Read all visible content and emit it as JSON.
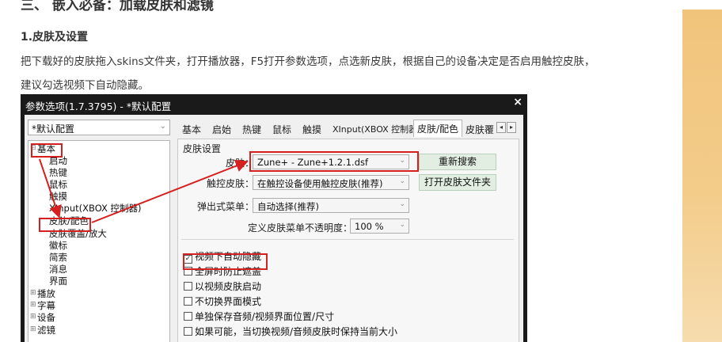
{
  "article": {
    "section_heading": "三、 嵌入必备：加载皮肤和滤镜",
    "sub_heading": "1.皮肤及设置",
    "paragraph_line1": "把下载好的皮肤拖入skins文件夹，打开播放器，F5打开参数选项，点选新皮肤，根据自己的设备决定是否启用触控皮肤，",
    "paragraph_line2": "建议勾选视频下自动隐藏。"
  },
  "window": {
    "title": "参数选项(1.7.3795) - *默认配置",
    "close_glyph": "×",
    "profile": "*默认配置"
  },
  "tree": {
    "basic": "基本",
    "start": "启动",
    "hotkey": "热键",
    "mouse": "鼠标",
    "touch": "触摸",
    "xinput": "XInput(XBOX 控制器)",
    "skin_color": "皮肤/配色",
    "skin_overlay": "皮肤覆盖/放大",
    "logo": "徽标",
    "minimal": "简索",
    "message": "消息",
    "ui": "界面",
    "playback": "播放",
    "subtitle": "字幕",
    "device": "设备",
    "filter": "滤镜"
  },
  "tabs": [
    "基本",
    "启始",
    "热键",
    "鼠标",
    "触摸",
    "XInput(XBOX 控制器)",
    "皮肤/配色",
    "皮肤覆"
  ],
  "tab_scroll": {
    "left": "◂",
    "right": "▸"
  },
  "skin_settings": {
    "group_label": "皮肤设置",
    "skin_label": "皮肤：",
    "skin_value": "Zune+ - Zune+1.2.1.dsf",
    "research_button": "重新搜索",
    "touch_skin_label": "触控皮肤：",
    "touch_skin_value": "在触控设备使用触控皮肤(推荐)",
    "open_folder_button": "打开皮肤文件夹",
    "popup_menu_label": "弹出式菜单：",
    "popup_menu_value": "自动选择(推荐)",
    "opacity_label": "定义皮肤菜单不透明度：",
    "opacity_value": "100 %"
  },
  "options": [
    {
      "label": "视频下自动隐藏",
      "checked": true
    },
    {
      "label": "全屏时防止遮盖",
      "checked": false
    },
    {
      "label": "以视频皮肤启动",
      "checked": false
    },
    {
      "label": "不切换界面模式",
      "checked": false
    },
    {
      "label": "单独保存音频/视频界面位置/尺寸",
      "checked": false
    },
    {
      "label": "如果可能，当切换视频/音频皮肤时保持当前大小",
      "checked": false
    }
  ],
  "glyphs": {
    "check": "✓",
    "chevron": "⌄",
    "expand": "⊞",
    "collapse": "⊟"
  },
  "colors": {
    "annotation_red": "#d62020",
    "side_gradient_top": "#f1c47b"
  }
}
